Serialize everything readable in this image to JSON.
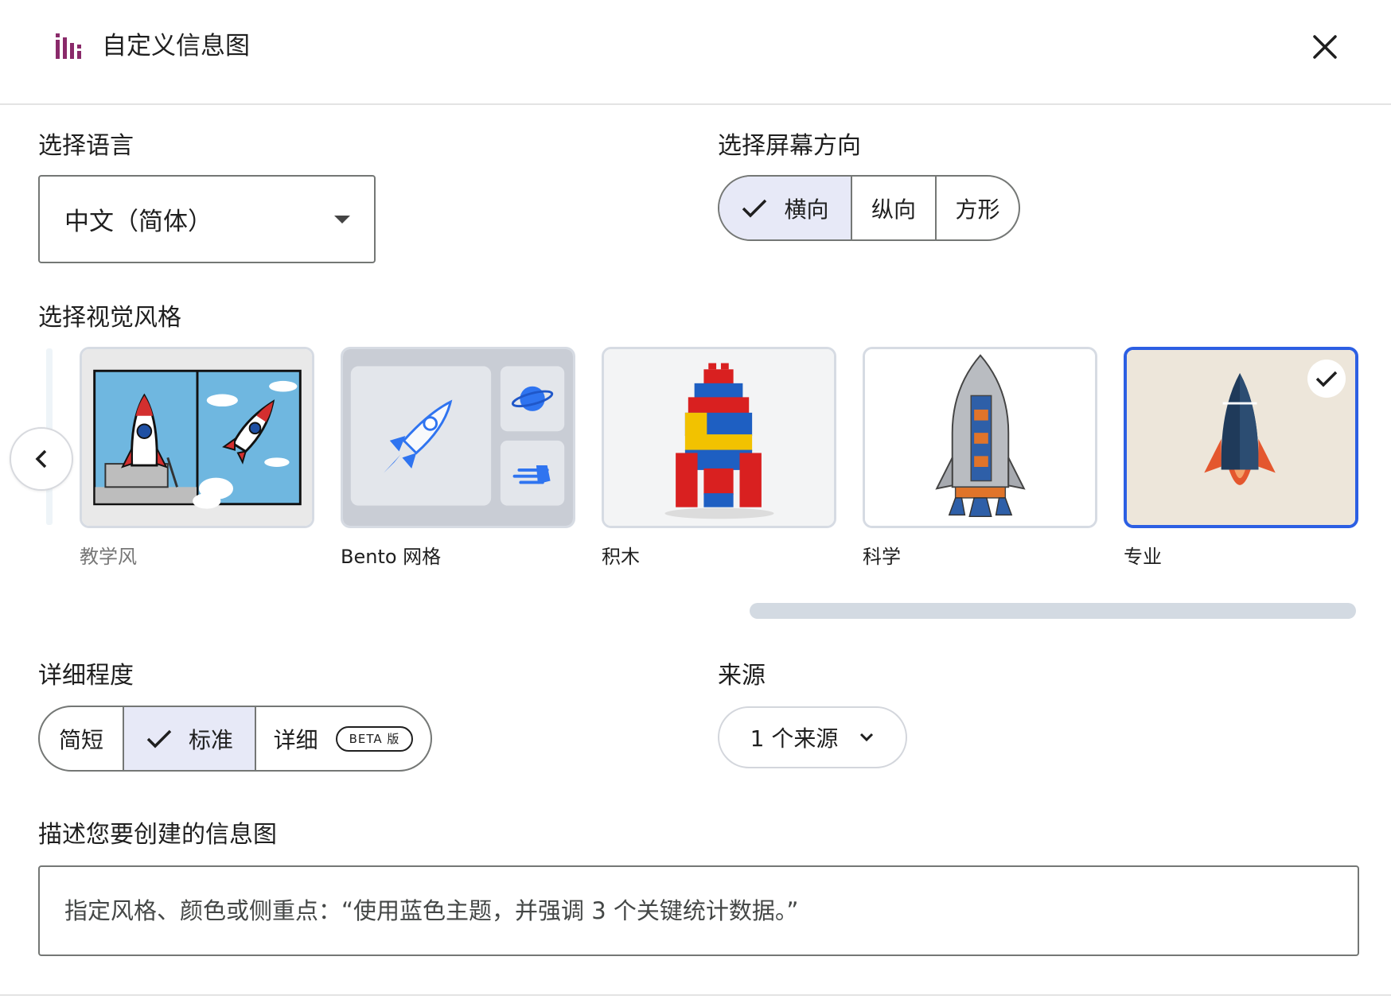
{
  "header": {
    "title": "自定义信息图",
    "icon": "bar-chart-icon",
    "accent": "#8a2a6a"
  },
  "language": {
    "label": "选择语言",
    "value": "中文（简体）"
  },
  "orientation": {
    "label": "选择屏幕方向",
    "options": [
      "横向",
      "纵向",
      "方形"
    ],
    "selected": "横向"
  },
  "visual_style": {
    "label": "选择视觉风格",
    "cards": [
      {
        "label": "教学风"
      },
      {
        "label": "Bento 网格"
      },
      {
        "label": "积木"
      },
      {
        "label": "科学"
      },
      {
        "label": "专业"
      }
    ],
    "selected": "专业",
    "selected_color": "#2c5fe3"
  },
  "detail": {
    "label": "详细程度",
    "options": [
      "简短",
      "标准",
      "详细"
    ],
    "selected": "标准",
    "beta_badge": "BETA 版"
  },
  "sources": {
    "label": "来源",
    "button": "1 个来源"
  },
  "description": {
    "label": "描述您要创建的信息图",
    "placeholder": "指定风格、颜色或侧重点：“使用蓝色主题，并强调 3 个关键统计数据。”"
  }
}
